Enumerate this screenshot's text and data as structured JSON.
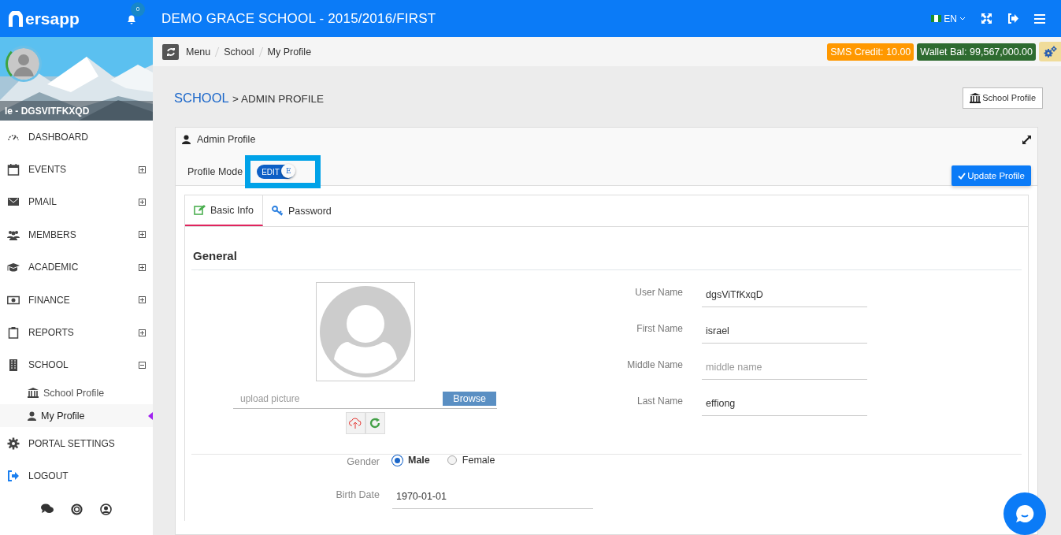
{
  "topbar": {
    "logo": "ersapp",
    "notifications": "0",
    "title": "DEMO GRACE SCHOOL - 2015/2016/FIRST",
    "language": "EN"
  },
  "sidebar": {
    "user": "le - DGSVITFKXQD",
    "items": [
      {
        "label": "DASHBOARD"
      },
      {
        "label": "EVENTS",
        "expanded": false
      },
      {
        "label": "PMAIL",
        "expanded": false
      },
      {
        "label": "MEMBERS",
        "expanded": false
      },
      {
        "label": "ACADEMIC",
        "expanded": false
      },
      {
        "label": "FINANCE",
        "expanded": false
      },
      {
        "label": "REPORTS",
        "expanded": false
      },
      {
        "label": "SCHOOL",
        "expanded": true,
        "children": [
          {
            "label": "School Profile",
            "selected": false
          },
          {
            "label": "My Profile",
            "selected": true
          }
        ]
      },
      {
        "label": "PORTAL SETTINGS"
      },
      {
        "label": "LOGOUT"
      }
    ]
  },
  "breadcrumb": [
    "Menu",
    "School",
    "My Profile"
  ],
  "badges": [
    {
      "text": "SMS Credit: 10.00",
      "color": "#ff9800"
    },
    {
      "text": "Wallet Bal: 99,567,000.00",
      "color": "#2e6b30"
    }
  ],
  "page_title": {
    "section": "SCHOOL",
    "page": "> ADMIN PROFILE"
  },
  "school_profile_button": "School Profile",
  "panel": {
    "title": "Admin Profile",
    "mode_label": "Profile Mode",
    "mode_toggle": {
      "label": "EDIT",
      "knob": "E",
      "on": true
    },
    "update_button": "Update Profile",
    "tabs": [
      {
        "label": "Basic Info",
        "selected": true
      },
      {
        "label": "Password",
        "selected": false
      }
    ],
    "section": "General",
    "upload": {
      "placeholder": "upload picture",
      "button": "Browse"
    },
    "fields": [
      {
        "label": "User Name",
        "value": "dgsViTfKxqD"
      },
      {
        "label": "First Name",
        "value": "israel"
      },
      {
        "label": "Middle Name",
        "placeholder": "middle name"
      },
      {
        "label": "Last Name",
        "value": "effiong"
      }
    ],
    "gender": {
      "label": "Gender",
      "options": [
        {
          "label": "Male",
          "selected": true
        },
        {
          "label": "Female",
          "selected": false
        }
      ]
    },
    "birth_date": {
      "label": "Birth Date",
      "value": "1970-01-01"
    }
  }
}
